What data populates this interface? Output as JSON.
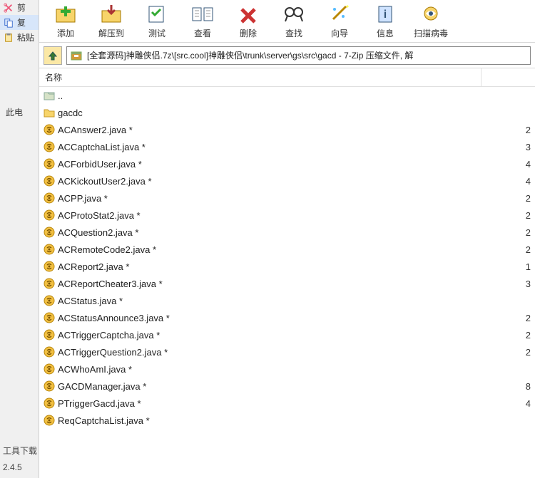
{
  "sidebar": {
    "cut": "剪",
    "copy": "复",
    "paste": "粘贴",
    "thispc": "此电",
    "dl": "工具下载",
    "version": "2.4.5"
  },
  "toolbar": [
    {
      "name": "add-button",
      "label": "添加"
    },
    {
      "name": "extract-button",
      "label": "解压到"
    },
    {
      "name": "test-button",
      "label": "测试"
    },
    {
      "name": "view-button",
      "label": "查看"
    },
    {
      "name": "delete-button",
      "label": "删除"
    },
    {
      "name": "find-button",
      "label": "查找"
    },
    {
      "name": "wizard-button",
      "label": "向导"
    },
    {
      "name": "info-button",
      "label": "信息"
    },
    {
      "name": "scan-button",
      "label": "扫描病毒"
    }
  ],
  "path": "[全套源码]神雕侠侣.7z\\[src.cool]神雕侠侣\\trunk\\server\\gs\\src\\gacd - 7-Zip 压缩文件, 解",
  "columns": {
    "name": "名称"
  },
  "rows": [
    {
      "type": "up",
      "label": ".."
    },
    {
      "type": "folder",
      "label": "gacdc",
      "val": ""
    },
    {
      "type": "java",
      "label": "ACAnswer2.java *",
      "val": "2"
    },
    {
      "type": "java",
      "label": "ACCaptchaList.java *",
      "val": "3"
    },
    {
      "type": "java",
      "label": "ACForbidUser.java *",
      "val": "4"
    },
    {
      "type": "java",
      "label": "ACKickoutUser2.java *",
      "val": "4"
    },
    {
      "type": "java",
      "label": "ACPP.java *",
      "val": "2"
    },
    {
      "type": "java",
      "label": "ACProtoStat2.java *",
      "val": "2"
    },
    {
      "type": "java",
      "label": "ACQuestion2.java *",
      "val": "2"
    },
    {
      "type": "java",
      "label": "ACRemoteCode2.java *",
      "val": "2"
    },
    {
      "type": "java",
      "label": "ACReport2.java *",
      "val": "1"
    },
    {
      "type": "java",
      "label": "ACReportCheater3.java *",
      "val": "3"
    },
    {
      "type": "java",
      "label": "ACStatus.java *",
      "val": ""
    },
    {
      "type": "java",
      "label": "ACStatusAnnounce3.java *",
      "val": "2"
    },
    {
      "type": "java",
      "label": "ACTriggerCaptcha.java *",
      "val": "2"
    },
    {
      "type": "java",
      "label": "ACTriggerQuestion2.java *",
      "val": "2"
    },
    {
      "type": "java",
      "label": "ACWhoAmI.java *",
      "val": ""
    },
    {
      "type": "java",
      "label": "GACDManager.java *",
      "val": "8"
    },
    {
      "type": "java",
      "label": "PTriggerGacd.java *",
      "val": "4"
    },
    {
      "type": "java",
      "label": "ReqCaptchaList.java *",
      "val": ""
    }
  ]
}
